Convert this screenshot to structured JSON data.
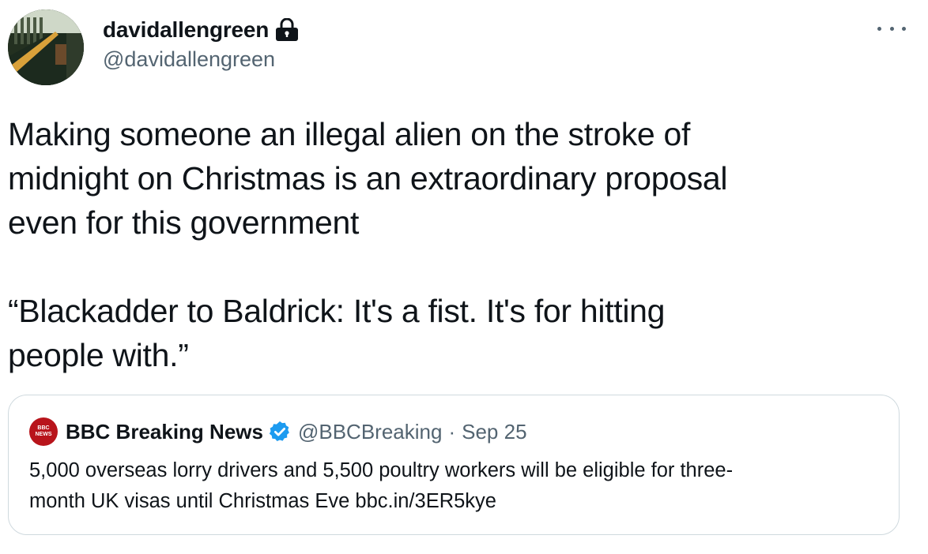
{
  "author": {
    "display_name": "davidallengreen",
    "handle": "@davidallengreen",
    "avatar_icon": "photo-avatar",
    "protected_icon": "lock-icon"
  },
  "more_icon": "more-horizontal-icon",
  "tweet": {
    "lines": [
      "Making someone an illegal alien on the stroke of",
      "midnight on Christmas is an extraordinary proposal",
      "even for this government",
      "“Blackadder to Baldrick: It's a fist. It's for hitting",
      "people with.”"
    ]
  },
  "quoted_tweet": {
    "display_name": "BBC Breaking News",
    "verified_icon": "verified-badge-icon",
    "handle": "@BBCBreaking",
    "separator": "·",
    "date": "Sep 25",
    "avatar_label_top": "BBC",
    "avatar_label_bottom": "NEWS",
    "text_lines": [
      "5,000 overseas lorry drivers and 5,500 poultry workers will be eligible for three-",
      "month UK visas until Christmas Eve bbc.in/3ER5kye"
    ]
  },
  "colors": {
    "text_primary": "#0f1419",
    "text_secondary": "#536471",
    "border": "#cfd9de",
    "verified_blue": "#1d9bf0",
    "bbc_red": "#b8141b"
  }
}
